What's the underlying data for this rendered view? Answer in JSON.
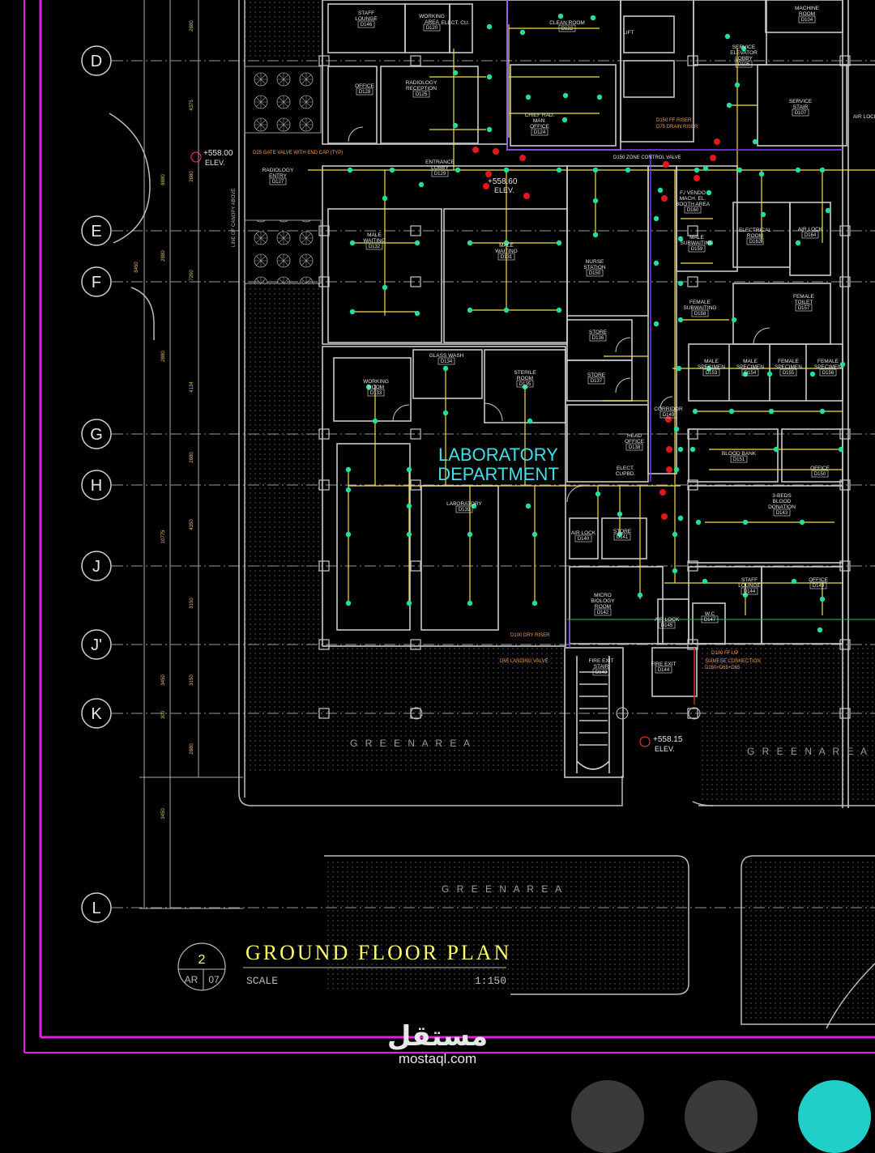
{
  "colors": {
    "background": "#000000",
    "border": "#e020e0",
    "wall": "#c8c8c8",
    "pipe": "#f0e040",
    "node": "#20e0a0",
    "alarm": "#ff2020",
    "label": "#e6e6e6",
    "dept": "#3fe0e8",
    "title": "#ffff66",
    "riser": "#8040ff",
    "fab_dark": "#3a3a3a",
    "fab_accent": "#20d0c8"
  },
  "grid_lines": [
    "D",
    "E",
    "F",
    "G",
    "H",
    "J",
    "J'",
    "K",
    "L"
  ],
  "dimensions": [
    "2880",
    "4375",
    "2880",
    "8880",
    "2880",
    "7200",
    "4134",
    "2880",
    "4350",
    "2880",
    "10775",
    "3150",
    "3150",
    "8450",
    "3450",
    "300",
    "2880",
    "3450"
  ],
  "rooms": [
    {
      "name": "STAFF LOUNGE",
      "code": "D146"
    },
    {
      "name": "WORKING AREA",
      "code": "D120"
    },
    {
      "name": "ELECT. CU.",
      "code": ""
    },
    {
      "name": "CLEAN ROOM",
      "code": "D122"
    },
    {
      "name": "LIFT",
      "code": ""
    },
    {
      "name": "SERVICE ELEVATOR LOBBY",
      "code": "D105"
    },
    {
      "name": "MACHINE ROOM",
      "code": "D104"
    },
    {
      "name": "OFFICE",
      "code": "D128"
    },
    {
      "name": "RADIOLOGY RECEPTION",
      "code": "D125"
    },
    {
      "name": "CHIEF RAD. MAN. OFFICE",
      "code": "D124"
    },
    {
      "name": "SERVICE STAIR",
      "code": "D107"
    },
    {
      "name": "AIR LOCK",
      "code": ""
    },
    {
      "name": "RADIOLOGY ENTRY",
      "code": "D127"
    },
    {
      "name": "ENTRANCE LOBBY",
      "code": "D129"
    },
    {
      "name": "F./ VENDO MACH. EL. BOOTH AREA",
      "code": "D160"
    },
    {
      "name": "MALE WAITING",
      "code": "D132"
    },
    {
      "name": "MALE WAITING",
      "code": "D131"
    },
    {
      "name": "MALE SUBWAITING",
      "code": "D159"
    },
    {
      "name": "ELECTRICAL ROOM",
      "code": "D162"
    },
    {
      "name": "AIR LOCK",
      "code": "D164"
    },
    {
      "name": "NURSE STATION",
      "code": "D150"
    },
    {
      "name": "FEMALE SUBWAITING",
      "code": "D158"
    },
    {
      "name": "FEMALE TOILET",
      "code": "D157"
    },
    {
      "name": "STORE",
      "code": "D136"
    },
    {
      "name": "STORE",
      "code": "D137"
    },
    {
      "name": "GLASS WASH",
      "code": "D134"
    },
    {
      "name": "STERILE ROOM",
      "code": "D135"
    },
    {
      "name": "WORKING ROOM",
      "code": "D133"
    },
    {
      "name": "MALE SPECIMEN",
      "code": "D153"
    },
    {
      "name": "MALE SPECIMEN",
      "code": "D154"
    },
    {
      "name": "FEMALE SPECIMEN",
      "code": "D155"
    },
    {
      "name": "FEMALE SPECIMEN",
      "code": "D156"
    },
    {
      "name": "CORRIDOR",
      "code": "D149"
    },
    {
      "name": "HEAD OFFICE",
      "code": "D138"
    },
    {
      "name": "ELECT. CUPBD.",
      "code": ""
    },
    {
      "name": "BLOOD BANK",
      "code": "D151"
    },
    {
      "name": "OFFICE",
      "code": "D150"
    },
    {
      "name": "LABORATORY",
      "code": "D139"
    },
    {
      "name": "AIR LOCK",
      "code": "D140"
    },
    {
      "name": "STORE",
      "code": "D141"
    },
    {
      "name": "3-BEDS BLOOD DONATION",
      "code": "D143"
    },
    {
      "name": "MICRO BIOLOGY ROOM",
      "code": "D142"
    },
    {
      "name": "STAFF LOUNGE",
      "code": "D144"
    },
    {
      "name": "OFFICE",
      "code": "D149"
    },
    {
      "name": "AIR LOCK",
      "code": "D145"
    },
    {
      "name": "W.C",
      "code": "D147"
    },
    {
      "name": "FIRE EXIT STAIR",
      "code": "D143"
    },
    {
      "name": "FIRE EXIT",
      "code": "D144"
    }
  ],
  "annotations": {
    "elev_top": "+558.00",
    "elev_top_label": "ELEV.",
    "elev_mid": "+558.60",
    "elev_mid_label": "ELEV.",
    "elev_bottom": "+558.15",
    "elev_bottom_label": "ELEV.",
    "gate_valve": "D25 GATE VALVE WITH END CAP (TYP)",
    "canopy": "LINE OF CANOPY ABOVE",
    "ff_riser": "D150 FF RISER",
    "drain_riser": "D75 DRAIN RISER",
    "zone_valve": "D150 ZONE CONTROL VALVE",
    "dry_riser": "D100 DRY RISER",
    "landing_valve": "D65 LANDING VALVE",
    "ff_up": "D100 FF UP",
    "siamese": "SIAMESE CONNECTION",
    "siamese_spec": "D150+D65+D65"
  },
  "green_areas": [
    "G R E E N   A R E A",
    "G R E E N   A R E A",
    "G R E E N   A R E A"
  ],
  "department": {
    "line1": "LABORATORY",
    "line2": "DEPARTMENT"
  },
  "title_block": {
    "number": "2",
    "sheet_prefix": "AR",
    "sheet_number": "07",
    "title": "GROUND  FLOOR  PLAN",
    "scale_label": "SCALE",
    "scale_value": "1:150"
  },
  "watermark": {
    "arabic": "مستقل",
    "latin": "mostaql.com"
  }
}
